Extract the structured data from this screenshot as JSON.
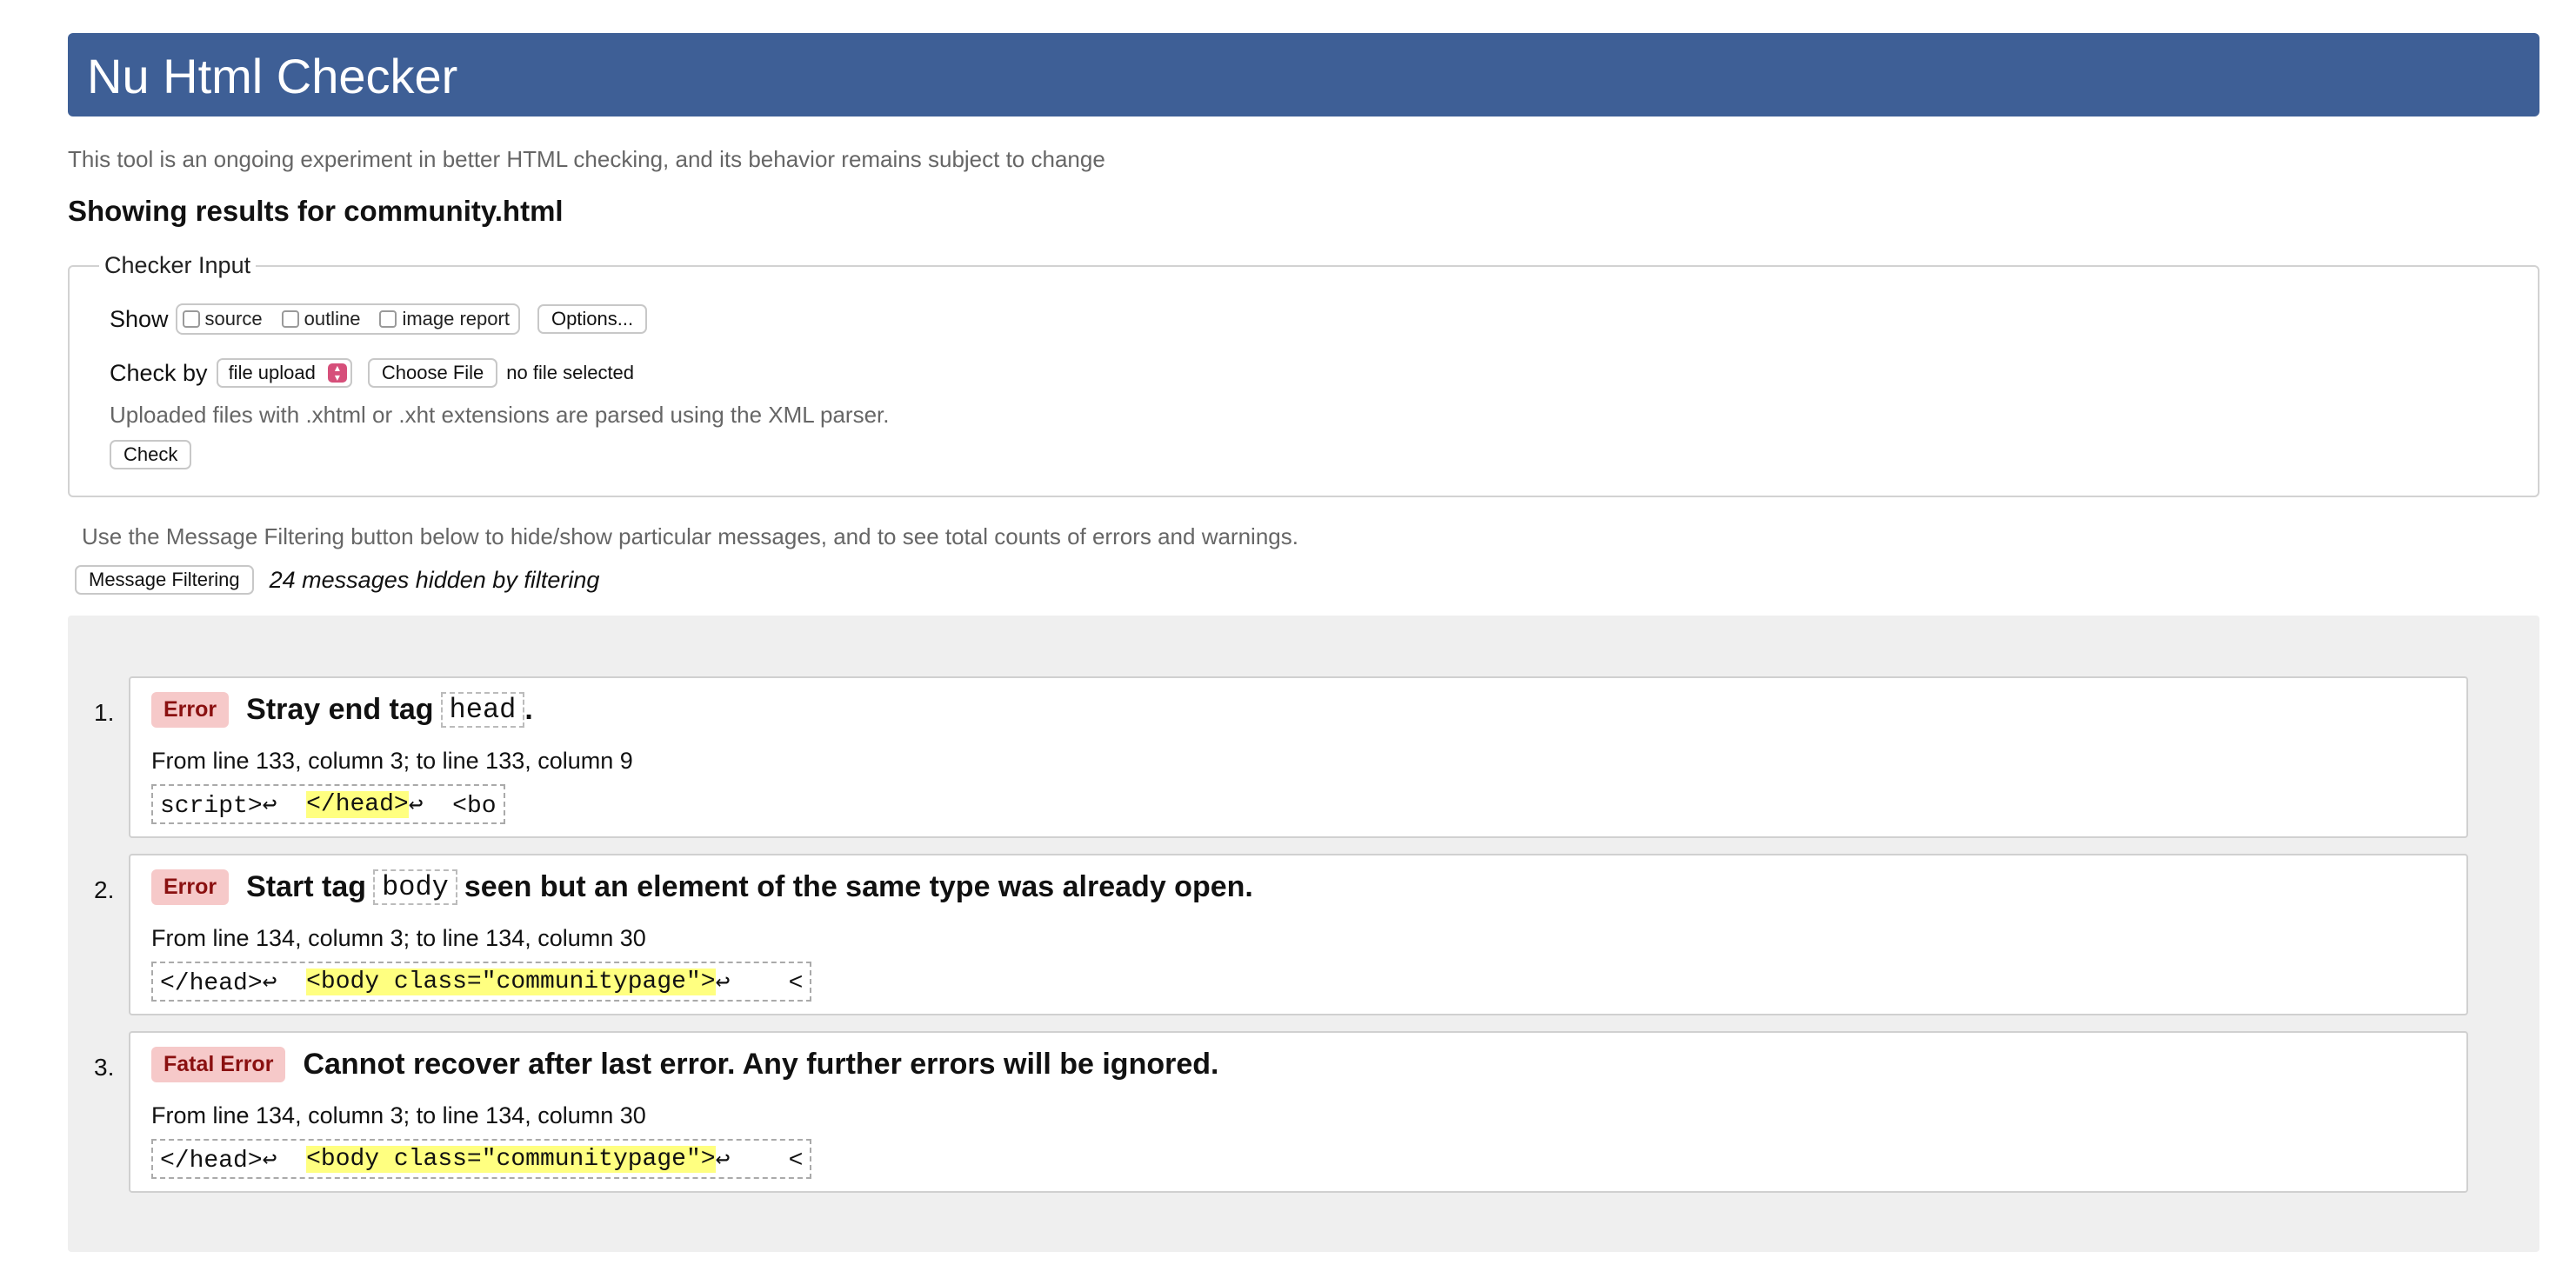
{
  "header": {
    "title": "Nu Html Checker"
  },
  "subtitle": "This tool is an ongoing experiment in better HTML checking, and its behavior remains subject to change",
  "results_for": "Showing results for community.html",
  "checker_input": {
    "legend": "Checker Input",
    "show_label": "Show",
    "show_options": [
      {
        "label": "source",
        "checked": false
      },
      {
        "label": "outline",
        "checked": false
      },
      {
        "label": "image report",
        "checked": false
      }
    ],
    "options_button": "Options...",
    "check_by_label": "Check by",
    "check_by_value": "file upload",
    "choose_file_button": "Choose File",
    "file_status": "no file selected",
    "note": "Uploaded files with .xhtml or .xht extensions are parsed using the XML parser.",
    "check_button": "Check"
  },
  "filtering": {
    "note": "Use the Message Filtering button below to hide/show particular messages, and to see total counts of errors and warnings.",
    "button": "Message Filtering",
    "hidden_count": "24 messages hidden by filtering"
  },
  "messages": [
    {
      "number": "1.",
      "type": "Error",
      "title_before": "Stray end tag",
      "title_code": "head",
      "title_after": ".",
      "location": "From line 133, column 3; to line 133, column 9",
      "extract_before": "script>↩  ",
      "extract_highlight": "</head>",
      "extract_after": "↩  <bo"
    },
    {
      "number": "2.",
      "type": "Error",
      "title_before": "Start tag",
      "title_code": "body",
      "title_after": "seen but an element of the same type was already open.",
      "location": "From line 134, column 3; to line 134, column 30",
      "extract_before": "</head>↩  ",
      "extract_highlight": "<body class=\"communitypage\">",
      "extract_after": "↩    <"
    },
    {
      "number": "3.",
      "type": "Fatal Error",
      "title_before": "Cannot recover after last error. Any further errors will be ignored.",
      "location": "From line 134, column 3; to line 134, column 30",
      "extract_before": "</head>↩  ",
      "extract_highlight": "<body class=\"communitypage\">",
      "extract_after": "↩    <"
    }
  ],
  "colors": {
    "banner": "#3e5f96",
    "error_badge_bg": "#f6c9c9",
    "error_badge_text": "#8a1010",
    "highlight": "#ffff80",
    "results_bg": "#efefef"
  }
}
